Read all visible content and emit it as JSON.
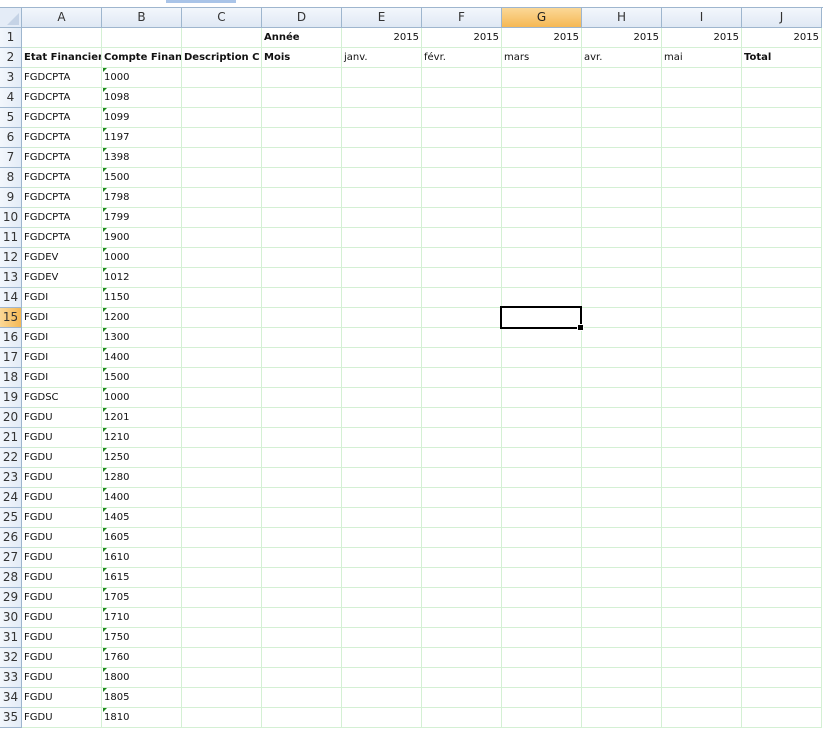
{
  "columns": [
    "A",
    "B",
    "C",
    "D",
    "E",
    "F",
    "G",
    "H",
    "I",
    "J"
  ],
  "selected_cell": "G15",
  "row1": {
    "D": "Année",
    "E": "2015",
    "F": "2015",
    "G": "2015",
    "H": "2015",
    "I": "2015",
    "J": "2015"
  },
  "row2": {
    "A": "Etat Financier",
    "B": "Compte Finan",
    "C": "Description C",
    "D": "Mois",
    "E": "janv.",
    "F": "févr.",
    "G": "mars",
    "H": "avr.",
    "I": "mai",
    "J": "Total"
  },
  "rows": [
    [
      "FGDCPTA",
      "1000"
    ],
    [
      "FGDCPTA",
      "1098"
    ],
    [
      "FGDCPTA",
      "1099"
    ],
    [
      "FGDCPTA",
      "1197"
    ],
    [
      "FGDCPTA",
      "1398"
    ],
    [
      "FGDCPTA",
      "1500"
    ],
    [
      "FGDCPTA",
      "1798"
    ],
    [
      "FGDCPTA",
      "1799"
    ],
    [
      "FGDCPTA",
      "1900"
    ],
    [
      "FGDEV",
      "1000"
    ],
    [
      "FGDEV",
      "1012"
    ],
    [
      "FGDI",
      "1150"
    ],
    [
      "FGDI",
      "1200"
    ],
    [
      "FGDI",
      "1300"
    ],
    [
      "FGDI",
      "1400"
    ],
    [
      "FGDI",
      "1500"
    ],
    [
      "FGDSC",
      "1000"
    ],
    [
      "FGDU",
      "1201"
    ],
    [
      "FGDU",
      "1210"
    ],
    [
      "FGDU",
      "1250"
    ],
    [
      "FGDU",
      "1280"
    ],
    [
      "FGDU",
      "1400"
    ],
    [
      "FGDU",
      "1405"
    ],
    [
      "FGDU",
      "1605"
    ],
    [
      "FGDU",
      "1610"
    ],
    [
      "FGDU",
      "1615"
    ],
    [
      "FGDU",
      "1705"
    ],
    [
      "FGDU",
      "1710"
    ],
    [
      "FGDU",
      "1750"
    ],
    [
      "FGDU",
      "1760"
    ],
    [
      "FGDU",
      "1800"
    ],
    [
      "FGDU",
      "1805"
    ],
    [
      "FGDU",
      "1810"
    ]
  ]
}
